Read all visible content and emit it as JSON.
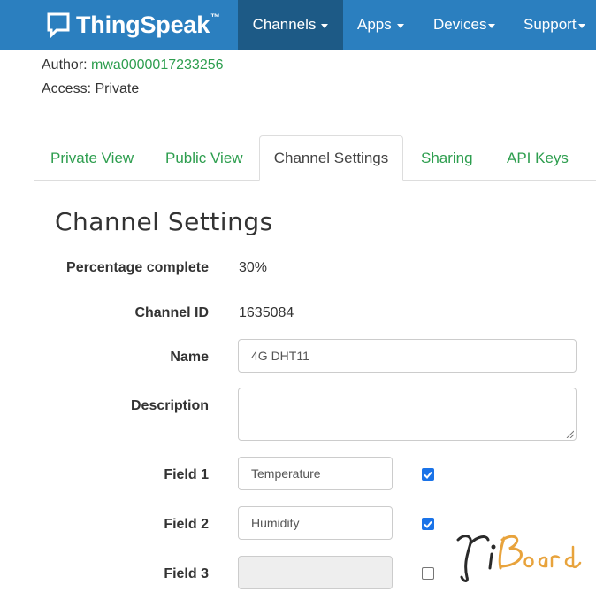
{
  "navbar": {
    "brand": "ThingSpeak",
    "brand_tm": "™",
    "items": [
      {
        "label": "Channels",
        "active": true
      },
      {
        "label": "Apps",
        "active": false
      },
      {
        "label": "Devices",
        "active": false
      },
      {
        "label": "Support",
        "active": false
      }
    ]
  },
  "meta": {
    "author_label": "Author:",
    "author_value": "mwa0000017233256",
    "access_label": "Access:",
    "access_value": "Private"
  },
  "tabs": [
    {
      "label": "Private View",
      "active": false
    },
    {
      "label": "Public View",
      "active": false
    },
    {
      "label": "Channel Settings",
      "active": true
    },
    {
      "label": "Sharing",
      "active": false
    },
    {
      "label": "API Keys",
      "active": false
    }
  ],
  "settings": {
    "title": "Channel Settings",
    "percentage_label": "Percentage complete",
    "percentage_value": "30%",
    "channel_id_label": "Channel ID",
    "channel_id_value": "1635084",
    "name_label": "Name",
    "name_value": "4G DHT11",
    "description_label": "Description",
    "description_value": "",
    "fields": [
      {
        "label": "Field 1",
        "value": "Temperature",
        "enabled": true
      },
      {
        "label": "Field 2",
        "value": "Humidity",
        "enabled": true
      },
      {
        "label": "Field 3",
        "value": "",
        "enabled": false
      }
    ]
  },
  "watermark": "YiBoard",
  "colors": {
    "navbar": "#2b7fbf",
    "navbar_active": "#1d5a86",
    "link_green": "#2e9e4f",
    "checkbox_blue": "#1a73e8"
  }
}
